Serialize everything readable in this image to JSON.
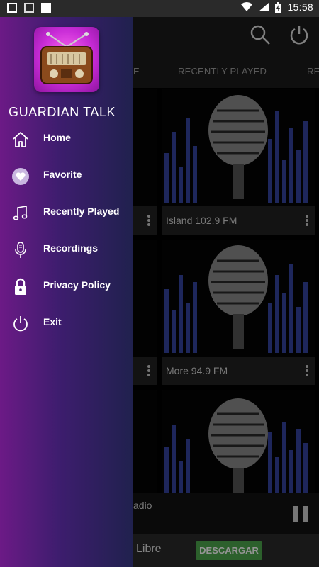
{
  "status_bar": {
    "time": "15:58"
  },
  "app_bar": {
    "search_icon": "search-icon",
    "power_icon": "power-icon"
  },
  "tabs": [
    {
      "label": "E"
    },
    {
      "label": "RECENTLY PLAYED"
    },
    {
      "label": "RE"
    }
  ],
  "stations": [
    {
      "name": ""
    },
    {
      "name": "Island 102.9 FM"
    },
    {
      "name": ""
    },
    {
      "name": "More 94.9 FM"
    },
    {
      "name": ""
    },
    {
      "name": ""
    }
  ],
  "player": {
    "now_playing": "adio"
  },
  "ad": {
    "text": "Libre",
    "button": "DESCARGAR"
  },
  "drawer": {
    "app_title": "GUARDIAN TALK",
    "items": [
      {
        "label": "Home",
        "icon": "home-icon"
      },
      {
        "label": "Favorite",
        "icon": "heart-icon"
      },
      {
        "label": "Recently Played",
        "icon": "music-note-icon"
      },
      {
        "label": "Recordings",
        "icon": "microphone-icon"
      },
      {
        "label": "Privacy Policy",
        "icon": "lock-icon"
      },
      {
        "label": "Exit",
        "icon": "power-icon"
      }
    ]
  },
  "colors": {
    "drawer_left": "#6c1a86",
    "drawer_right": "#20214e",
    "ad_button": "#4ca64c"
  }
}
